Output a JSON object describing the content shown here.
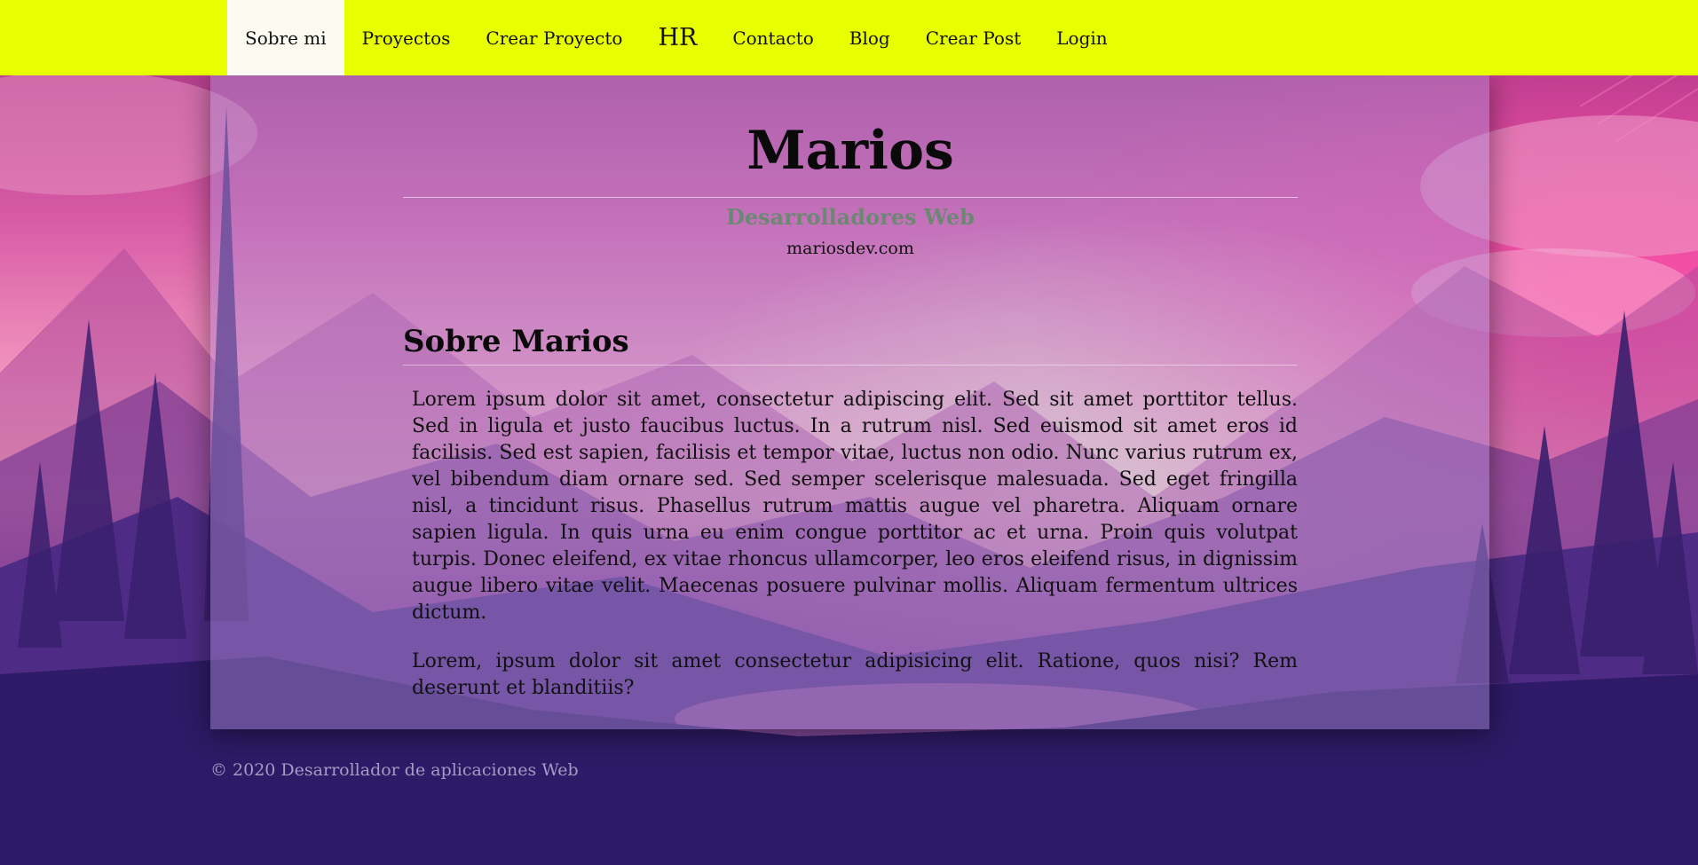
{
  "nav": {
    "items": [
      {
        "label": "Sobre mi",
        "active": true
      },
      {
        "label": "Proyectos"
      },
      {
        "label": "Crear Proyecto"
      },
      {
        "label": "HR"
      },
      {
        "label": "Contacto"
      },
      {
        "label": "Blog"
      },
      {
        "label": "Crear Post"
      },
      {
        "label": "Login"
      }
    ]
  },
  "header": {
    "title": "Marios",
    "subtitle": "Desarrolladores Web",
    "domain": "mariosdev.com"
  },
  "about": {
    "heading": "Sobre Marios",
    "paragraphs": [
      "Lorem ipsum dolor sit amet, consectetur adipiscing elit. Sed sit amet porttitor tellus. Sed in ligula et justo faucibus luctus. In a rutrum nisl. Sed euismod sit amet eros id facilisis. Sed est sapien, facilisis et tempor vitae, luctus non odio. Nunc varius rutrum ex, vel bibendum diam ornare sed. Sed semper scelerisque malesuada. Sed eget fringilla nisl, a tincidunt risus. Phasellus rutrum mattis augue vel pharetra. Aliquam ornare sapien ligula. In quis urna eu enim congue porttitor ac et urna. Proin quis volutpat turpis. Donec eleifend, ex vitae rhoncus ullamcorper, leo eros eleifend risus, in dignissim augue libero vitae velit. Maecenas posuere pulvinar mollis. Aliquam fermentum ultrices dictum.",
      "Lorem, ipsum dolor sit amet consectetur adipisicing elit. Ratione, quos nisi? Rem deserunt et blanditiis?"
    ]
  },
  "footer": {
    "text": "© 2020 Desarrollador de aplicaciones Web"
  },
  "colors": {
    "nav_bg": "#e8ff00",
    "nav_active_bg": "#fbfbf2",
    "subtitle": "#6c8872",
    "footer_text": "#a79ac4"
  }
}
